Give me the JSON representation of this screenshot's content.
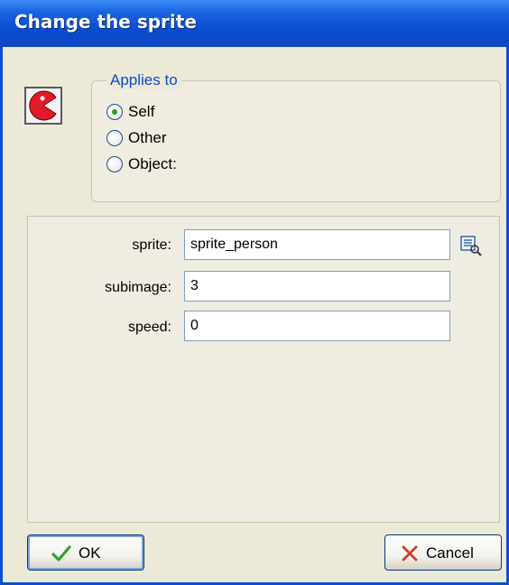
{
  "window": {
    "title": "Change the sprite"
  },
  "action_icon": "pacman-sprite-icon",
  "applies_to": {
    "legend": "Applies to",
    "options": [
      {
        "label": "Self",
        "selected": true
      },
      {
        "label": "Other",
        "selected": false
      },
      {
        "label": "Object:",
        "selected": false
      }
    ]
  },
  "fields": {
    "sprite": {
      "label": "sprite:",
      "value": "sprite_person"
    },
    "subimage": {
      "label": "subimage:",
      "value": "3"
    },
    "speed": {
      "label": "speed:",
      "value": "0"
    }
  },
  "buttons": {
    "ok": "OK",
    "cancel": "Cancel"
  },
  "colors": {
    "title_bar": "#0b4dd1",
    "legend_text": "#0c49d0",
    "ok_check": "#2fa32f",
    "cancel_x": "#d23a2a",
    "pacman": "#e21b2a"
  }
}
